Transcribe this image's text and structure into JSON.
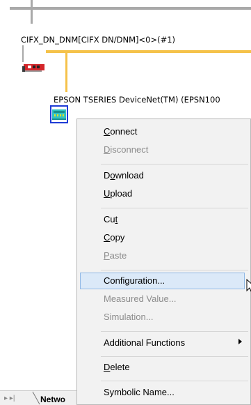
{
  "master": {
    "label": "CIFX_DN_DNM[CIFX DN/DNM]<0>(#1)"
  },
  "slave": {
    "label": "EPSON TSERIES DeviceNet(TM) (EPSN100"
  },
  "context_menu": {
    "connect": "Connect",
    "disconnect": "Disconnect",
    "download": "Download",
    "upload": "Upload",
    "cut": "Cut",
    "copy": "Copy",
    "paste": "Paste",
    "configuration": "Configuration...",
    "measured_value": "Measured Value...",
    "simulation": "Simulation...",
    "additional_functions": "Additional Functions",
    "delete": "Delete",
    "symbolic_name": "Symbolic Name..."
  },
  "bottom_tab": {
    "label": "Netwo",
    "arrows": "▸ ▸|"
  },
  "colors": {
    "orange_bus": "#f5c24a",
    "gray_bus": "#a9a9a9",
    "device_border": "#1f3cd6",
    "menu_highlight": "#dbe9f8",
    "disabled_text": "#8c8c8c"
  },
  "icons": [
    "network-card-icon",
    "devicenet-slave-icon",
    "mouse-cursor-icon",
    "submenu-arrow-icon"
  ]
}
